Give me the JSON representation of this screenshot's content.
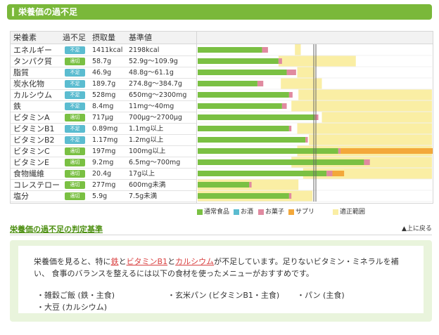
{
  "header": {
    "title": "栄養価の過不足"
  },
  "table": {
    "columns": [
      "栄養素",
      "過不足",
      "摂取量",
      "基準値"
    ],
    "rows": [
      {
        "name": "エネルギー",
        "status": "不足",
        "kind": "short",
        "intake": "1411kcal",
        "standard": "2198kcal"
      },
      {
        "name": "タンパク質",
        "status": "適切",
        "kind": "ok",
        "intake": "58.7g",
        "standard": "52.9g〜109.9g"
      },
      {
        "name": "脂質",
        "status": "不足",
        "kind": "short",
        "intake": "46.9g",
        "standard": "48.8g〜61.1g"
      },
      {
        "name": "炭水化物",
        "status": "不足",
        "kind": "short",
        "intake": "189.7g",
        "standard": "274.8g〜384.7g"
      },
      {
        "name": "カルシウム",
        "status": "不足",
        "kind": "short",
        "intake": "528mg",
        "standard": "650mg〜2300mg"
      },
      {
        "name": "鉄",
        "status": "不足",
        "kind": "short",
        "intake": "8.4mg",
        "standard": "11mg〜40mg"
      },
      {
        "name": "ビタミンA",
        "status": "適切",
        "kind": "ok",
        "intake": "717μg",
        "standard": "700μg〜2700μg"
      },
      {
        "name": "ビタミンB1",
        "status": "不足",
        "kind": "short",
        "intake": "0.89mg",
        "standard": "1.1mg以上"
      },
      {
        "name": "ビタミンB2",
        "status": "不足",
        "kind": "short",
        "intake": "1.17mg",
        "standard": "1.2mg以上"
      },
      {
        "name": "ビタミンC",
        "status": "適切",
        "kind": "ok",
        "intake": "197mg",
        "standard": "100mg以上"
      },
      {
        "name": "ビタミンE",
        "status": "適切",
        "kind": "ok",
        "intake": "9.2mg",
        "standard": "6.5mg〜700mg"
      },
      {
        "name": "食物繊維",
        "status": "適切",
        "kind": "ok",
        "intake": "20.4g",
        "standard": "17g以上"
      },
      {
        "name": "コレステロー",
        "status": "適切",
        "kind": "ok",
        "intake": "277mg",
        "standard": "600mg未満"
      },
      {
        "name": "塩分",
        "status": "適切",
        "kind": "ok",
        "intake": "5.9g",
        "standard": "7.5g未満"
      }
    ]
  },
  "colors": {
    "header_green": "#7ab83a",
    "badge_short": "#5bbcd0",
    "badge_ok": "#7ac043",
    "food": "#7ac043",
    "alcohol": "#5bbcd0",
    "sweets": "#e08aa0",
    "supplement": "#f3a83a",
    "range": "#faeea4"
  },
  "chart_data": {
    "type": "bar",
    "stacked": true,
    "orientation": "horizontal",
    "categories": [
      "エネルギー",
      "タンパク質",
      "脂質",
      "炭水化物",
      "カルシウム",
      "鉄",
      "ビタミンA",
      "ビタミンB1",
      "ビタミンB2",
      "ビタミンC",
      "ビタミンE",
      "食物繊維",
      "コレステロー",
      "塩分"
    ],
    "xlim": [
      0,
      200
    ],
    "range": [
      [
        83,
        88
      ],
      [
        69,
        135
      ],
      [
        85,
        100
      ],
      [
        71,
        106
      ],
      [
        86,
        200
      ],
      [
        80,
        200
      ],
      [
        106,
        200
      ],
      [
        85,
        200
      ],
      [
        95,
        200
      ],
      [
        85,
        200
      ],
      [
        80,
        200
      ],
      [
        90,
        200
      ],
      [
        0,
        86
      ],
      [
        0,
        98
      ]
    ],
    "series": [
      {
        "name": "通常食品",
        "key": "food",
        "values": [
          55,
          69,
          76,
          51,
          78,
          72,
          100,
          78,
          92,
          120,
          142,
          110,
          44,
          78
        ]
      },
      {
        "name": "お酒",
        "key": "alcohol",
        "values": [
          0,
          0,
          0,
          0,
          0,
          0,
          0,
          0,
          0,
          0,
          0,
          0,
          0,
          0
        ]
      },
      {
        "name": "お菓子",
        "key": "sweets",
        "values": [
          5,
          3,
          8,
          5,
          3,
          4,
          3,
          2,
          2,
          2,
          5,
          5,
          2,
          2
        ]
      },
      {
        "name": "サプリ",
        "key": "supplement",
        "values": [
          0,
          0,
          0,
          0,
          0,
          0,
          0,
          0,
          0,
          80,
          0,
          10,
          0,
          0
        ]
      }
    ],
    "legend": [
      "通常食品",
      "お酒",
      "お菓子",
      "サプリ",
      "適正範囲"
    ],
    "legend_position": "bottom",
    "reference_line": 100
  },
  "links": {
    "criteria": "栄養価の過不足の判定基準",
    "to_top": "上に戻る"
  },
  "advice": {
    "p1": "栄養価を見ると、特に",
    "h1": "鉄",
    "p2": "と",
    "h2": "ビタミンB1",
    "p3": "と",
    "h3": "カルシウム",
    "p4": "が不足しています。足りないビタミン・ミネラルを補い、 食事のバランスを整えるには以下の食材を使ったメニューがおすすめです。",
    "foods": [
      "・雑穀ご飯 (鉄・主食)",
      "・玄米パン (ビタミンB1・主食)",
      "・パン (主食)",
      "・大豆 (カルシウム)"
    ]
  }
}
